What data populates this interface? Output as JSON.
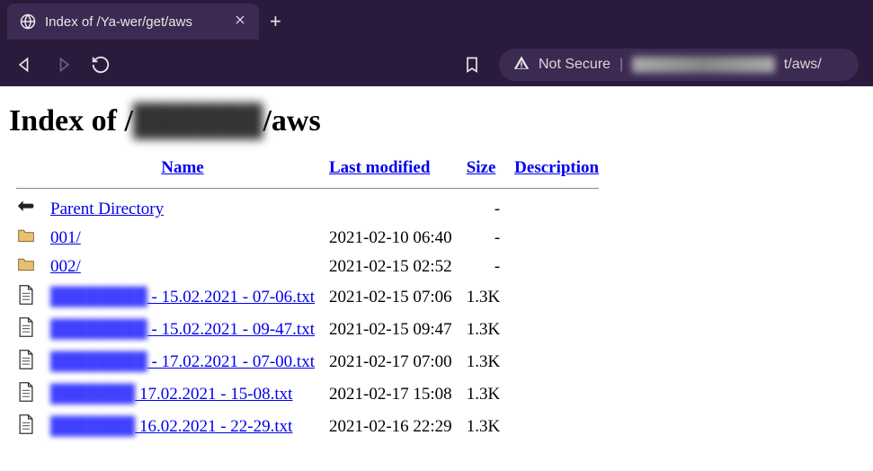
{
  "browser": {
    "tab_title": "Index of /Ya-wer/get/aws",
    "url_label_notsecure": "Not Secure",
    "url_redacted": "██████████████",
    "url_suffix": "t/aws/"
  },
  "page": {
    "heading_prefix": "Index of /",
    "heading_redacted": "██████",
    "heading_suffix": "/aws"
  },
  "columns": {
    "name": "Name",
    "lastmod": "Last modified",
    "size": "Size",
    "desc": "Description"
  },
  "rows": [
    {
      "icon": "back",
      "name": "Parent Directory",
      "redacted_prefix": "",
      "lastmod": "",
      "size": "-",
      "desc": ""
    },
    {
      "icon": "folder",
      "name": "001/",
      "redacted_prefix": "",
      "lastmod": "2021-02-10 06:40",
      "size": "-",
      "desc": ""
    },
    {
      "icon": "folder",
      "name": "002/",
      "redacted_prefix": "",
      "lastmod": "2021-02-15 02:52",
      "size": "-",
      "desc": ""
    },
    {
      "icon": "file",
      "redacted_prefix": "████████",
      "name": " -  15.02.2021  -  07-06.txt",
      "lastmod": "2021-02-15 07:06",
      "size": "1.3K",
      "desc": ""
    },
    {
      "icon": "file",
      "redacted_prefix": "████████",
      "name": " -  15.02.2021  -  09-47.txt",
      "lastmod": "2021-02-15 09:47",
      "size": "1.3K",
      "desc": ""
    },
    {
      "icon": "file",
      "redacted_prefix": "████████",
      "name": " -  17.02.2021  -  07-00.txt",
      "lastmod": "2021-02-17 07:00",
      "size": "1.3K",
      "desc": ""
    },
    {
      "icon": "file",
      "redacted_prefix": "███████",
      "name": " 17.02.2021  -  15-08.txt",
      "lastmod": "2021-02-17 15:08",
      "size": "1.3K",
      "desc": ""
    },
    {
      "icon": "file",
      "redacted_prefix": "███████",
      "name": " 16.02.2021  -  22-29.txt",
      "lastmod": "2021-02-16 22:29",
      "size": "1.3K",
      "desc": ""
    }
  ]
}
